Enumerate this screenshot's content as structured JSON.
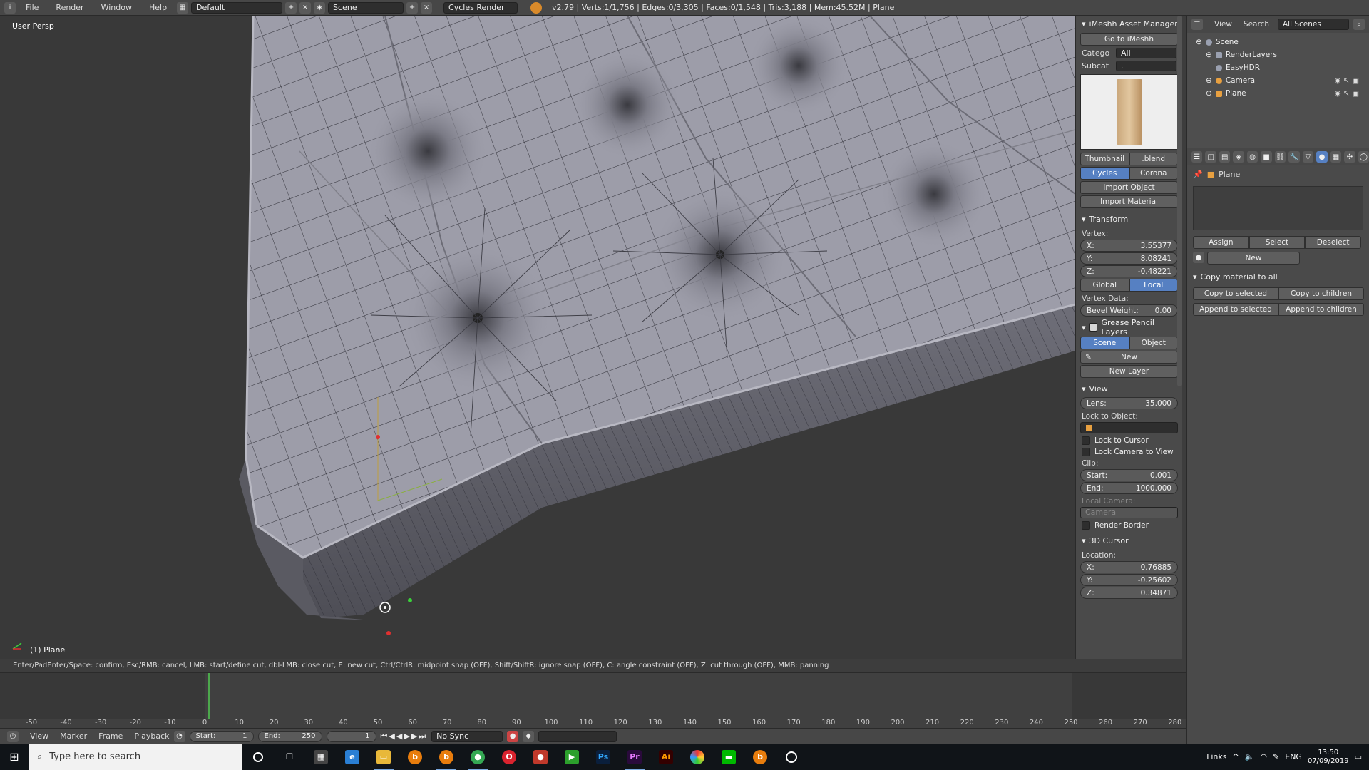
{
  "topbar": {
    "menus": [
      "File",
      "Render",
      "Window",
      "Help"
    ],
    "layout": "Default",
    "scene": "Scene",
    "engine": "Cycles Render",
    "stats": "v2.79 | Verts:1/1,756 | Edges:0/3,305 | Faces:0/1,548 | Tris:3,188 | Mem:45.52M | Plane"
  },
  "viewport": {
    "view_name": "User Persp",
    "object_label": "(1) Plane"
  },
  "npanel": {
    "imeshh_title": "iMeshh Asset Manager",
    "go_to": "Go to iMeshh",
    "category_label": "Catego",
    "category_value": "All",
    "subcat_label": "Subcat",
    "subcat_value": ".",
    "thumbnail_tab": "Thumbnail",
    "blend_tab": ".blend",
    "engines": [
      "Cycles",
      "Corona"
    ],
    "import_object": "Import Object",
    "import_material": "Import Material",
    "transform_title": "Transform",
    "vertex_label": "Vertex:",
    "vx_label": "X:",
    "vx": "3.55377",
    "vy_label": "Y:",
    "vy": "8.08241",
    "vz_label": "Z:",
    "vz": "-0.48221",
    "global": "Global",
    "local": "Local",
    "vertex_data": "Vertex Data:",
    "bevel_label": "Bevel Weight:",
    "bevel": "0.00",
    "grease_title": "Grease Pencil Layers",
    "gp_scene": "Scene",
    "gp_object": "Object",
    "gp_new": "New",
    "new_layer": "New Layer",
    "view_title": "View",
    "lens_label": "Lens:",
    "lens": "35.000",
    "lock_to_object": "Lock to Object:",
    "lock_cursor": "Lock to Cursor",
    "lock_camera": "Lock Camera to View",
    "clip": "Clip:",
    "clip_start_label": "Start:",
    "clip_start": "0.001",
    "clip_end_label": "End:",
    "clip_end": "1000.000",
    "local_camera": "Local Camera:",
    "camera": "Camera",
    "render_border": "Render Border",
    "cursor_title": "3D Cursor",
    "location": "Location:",
    "cx_label": "X:",
    "cx": "0.76885",
    "cy_label": "Y:",
    "cy": "-0.25602",
    "cz_label": "Z:",
    "cz": "0.34871"
  },
  "outliner": {
    "view": "View",
    "search": "Search",
    "filter": "All Scenes",
    "items": [
      "Scene",
      "RenderLayers",
      "EasyHDR",
      "Camera",
      "Plane"
    ]
  },
  "props": {
    "object": "Plane",
    "assign": "Assign",
    "select": "Select",
    "deselect": "Deselect",
    "new": "New",
    "copy_material": "Copy material to all",
    "copy_selected": "Copy to selected",
    "copy_children": "Copy to children",
    "append_selected": "Append to selected",
    "append_children": "Append to children"
  },
  "status": {
    "text": "Enter/PadEnter/Space: confirm, Esc/RMB: cancel, LMB: start/define cut, dbl-LMB: close cut, E: new cut, Ctrl/CtrlR: midpoint snap (OFF), Shift/ShiftR: ignore snap (OFF), C: angle constraint (OFF), Z: cut through (OFF), MMB: panning"
  },
  "timeline": {
    "ticks": [
      "-50",
      "-40",
      "-30",
      "-20",
      "-10",
      "0",
      "10",
      "20",
      "30",
      "40",
      "50",
      "60",
      "70",
      "80",
      "90",
      "100",
      "110",
      "120",
      "130",
      "140",
      "150",
      "160",
      "170",
      "180",
      "190",
      "200",
      "210",
      "220",
      "230",
      "240",
      "250",
      "260",
      "270",
      "280"
    ],
    "current_frame": 1,
    "menu": [
      "View",
      "Marker",
      "Frame",
      "Playback"
    ],
    "start_label": "Start:",
    "start": "1",
    "end_label": "End:",
    "end": "250",
    "frame": "1",
    "sync": "No Sync"
  },
  "taskbar": {
    "search_placeholder": "Type here to search",
    "apps": [
      "calculator",
      "edge",
      "explorer",
      "blender",
      "blender",
      "chrome",
      "opera",
      "record",
      "media",
      "photoshop",
      "premiere",
      "illustrator",
      "photos",
      "line",
      "blender",
      "clock"
    ],
    "links": "Links",
    "lang": "ENG",
    "time": "13:50",
    "date": "07/09/2019"
  },
  "colors": {
    "accent": "#5680c2",
    "panel": "#4a4a4a",
    "viewport": "#393939",
    "mesh": "#9a9aa6"
  }
}
